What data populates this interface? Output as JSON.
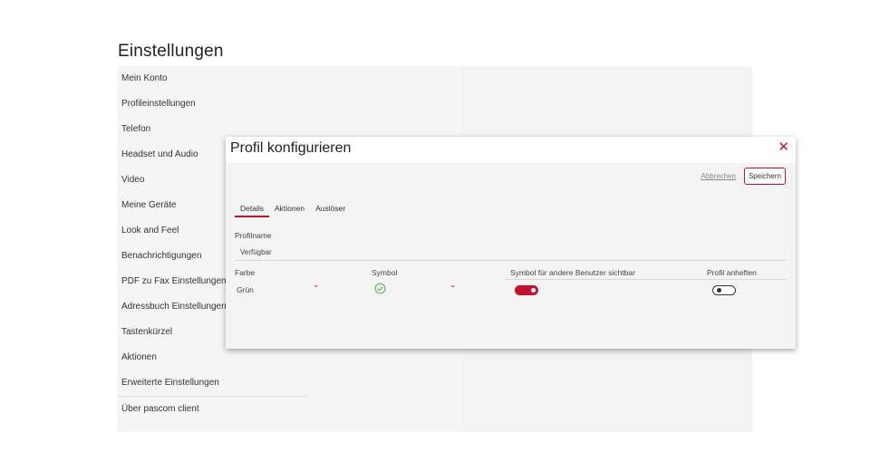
{
  "page": {
    "title": "Einstellungen"
  },
  "menu": {
    "items": [
      {
        "label": "Mein Konto"
      },
      {
        "label": "Profileinstellungen"
      },
      {
        "label": "Telefon"
      },
      {
        "label": "Headset und Audio"
      },
      {
        "label": "Video"
      },
      {
        "label": "Meine Geräte"
      },
      {
        "label": "Look and Feel"
      },
      {
        "label": "Benachrichtigungen"
      },
      {
        "label": "PDF zu Fax Einstellungen"
      },
      {
        "label": "Adressbuch Einstellungen"
      },
      {
        "label": "Tastenkürzel"
      },
      {
        "label": "Aktionen"
      },
      {
        "label": "Erweiterte Einstellungen"
      },
      {
        "label": "Über pascom client"
      }
    ]
  },
  "dialog": {
    "title": "Profil konfigurieren",
    "close_glyph": "✕",
    "cancel_label": "Abbrechen",
    "save_label": "Speichern",
    "tabs": [
      {
        "label": "Details",
        "active": true
      },
      {
        "label": "Aktionen",
        "active": false
      },
      {
        "label": "Auslöser",
        "active": false
      }
    ],
    "profile_name": {
      "label": "Profilname",
      "value": "Verfügbar"
    },
    "color": {
      "label": "Farbe",
      "value": "Grün"
    },
    "symbol": {
      "label": "Symbol",
      "icon": "check-circle-icon"
    },
    "visible_to_others": {
      "label": "Symbol für andere Benutzer sichtbar",
      "on": true
    },
    "pin_profile": {
      "label": "Profil anheften",
      "on": false
    },
    "chevron_glyph": "⌄"
  },
  "colors": {
    "accent": "#c8102e",
    "symbol_green": "#4caf50"
  }
}
